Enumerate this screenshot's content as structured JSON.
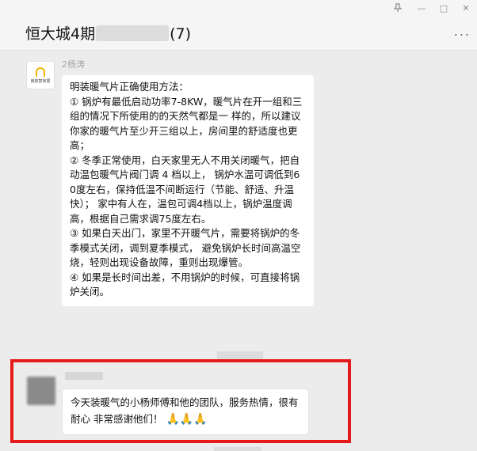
{
  "window": {
    "pin_icon": "pin-icon",
    "minimize": "—",
    "maximize": "□",
    "close": "✕"
  },
  "header": {
    "title_prefix": "恒大城4期",
    "title_suffix": "(7)",
    "more": "..."
  },
  "message1": {
    "avatar_text": "南航智家居",
    "sender": "2杨涛",
    "lines": [
      "明装暖气片正确使用方法：",
      "① 锅炉有最低启动功率7-8KW，暖气片在开一组和三组的情况下所使用的的天然气都是一 样的，所以建议你家的暖气片至少开三组以上，房间里的舒适度也更高；",
      "② 冬季正常使用，白天家里无人不用关闭暖气，把自动温包暖气片阀门调 4 档以上， 锅炉水温可调低到60度左右，保持低温不间断运行（节能、舒适、升温快）； 家中有人在，温包可调4档以上，锅炉温度调高，根据自己需求调75度左右。",
      "③ 如果白天出门，家里不开暖气片，需要将锅炉的冬季模式关闭，调到夏季模式， 避免锅炉长时间高温空烧，轻则出现设备故障，重则出现爆管。",
      "④ 如果是长时间出差，不用锅炉的时候，可直接将锅炉关闭。"
    ]
  },
  "message2": {
    "text": "今天装暖气的小杨师傅和他的团队，服务热情，很有耐心 非常感谢他们！",
    "emoji": "🙏🙏🙏"
  },
  "colors": {
    "highlight": "#e51b1b",
    "background": "#ececec"
  }
}
